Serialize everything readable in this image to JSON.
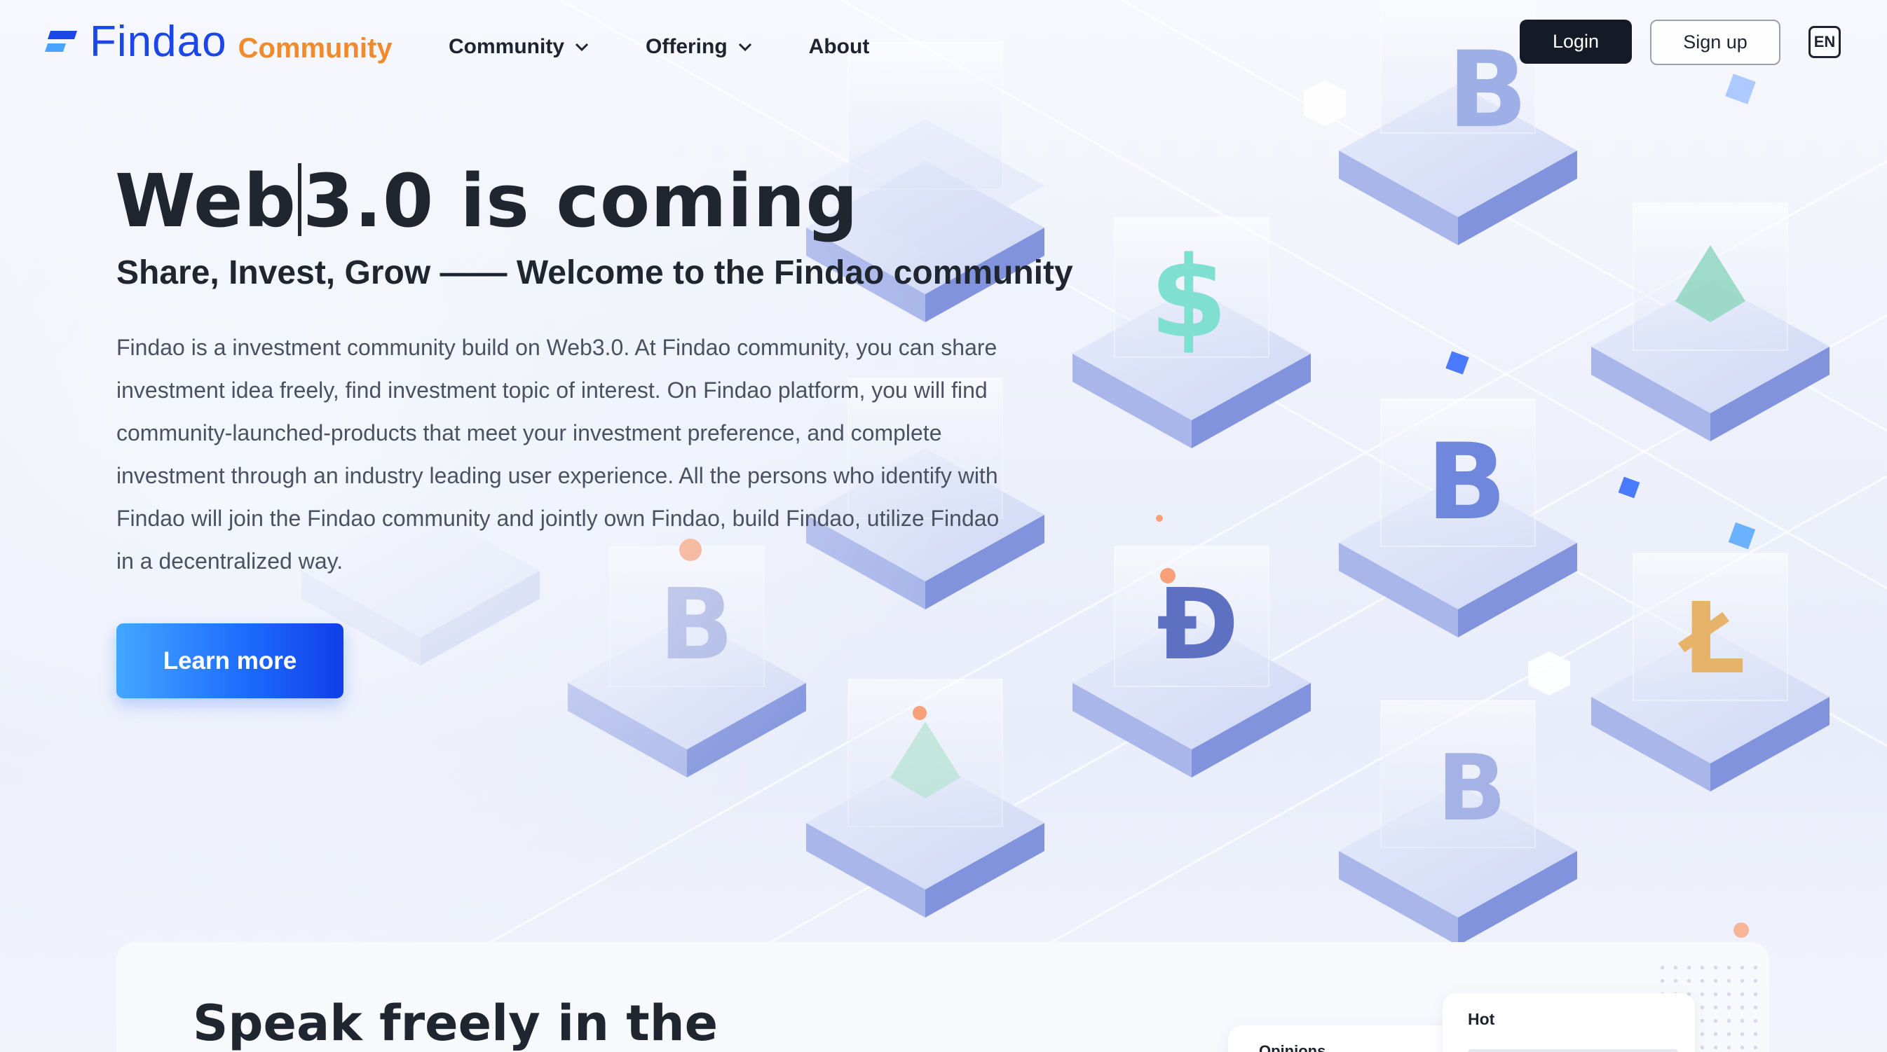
{
  "header": {
    "logo_text": "Findao",
    "logo_sub": "Community",
    "nav": [
      {
        "label": "Community",
        "has_dropdown": true
      },
      {
        "label": "Offering",
        "has_dropdown": true
      },
      {
        "label": "About",
        "has_dropdown": false
      }
    ],
    "login_label": "Login",
    "signup_label": "Sign up",
    "language": "EN"
  },
  "hero": {
    "title_part1": "Web",
    "title_part2": "3.0 is coming",
    "subtitle": "Share, Invest, Grow —— Welcome to the Findao community",
    "description": "Findao is a investment community build on Web3.0. At Findao community, you can share investment idea freely, find investment topic of interest. On Findao platform, you will find community-launched-products that meet your investment preference, and complete investment through an industry leading user experience. All the persons who identify with Findao will join the Findao community and jointly own Findao, build Findao, utilize Findao in a decentralized way.",
    "cta_label": "Learn more"
  },
  "section": {
    "title": "Speak freely in the",
    "hot_label": "Hot",
    "opinions_label": "Opinions"
  },
  "colors": {
    "brand_blue": "#1a47e6",
    "brand_orange": "#f08a2c",
    "dark": "#141b26",
    "cta_gradient_start": "#43a7ff",
    "cta_gradient_end": "#0f3fe8"
  }
}
